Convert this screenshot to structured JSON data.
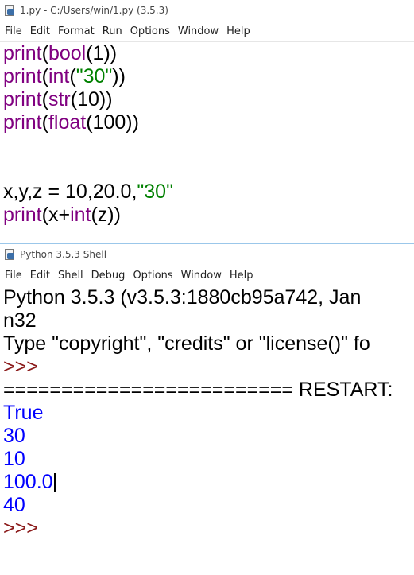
{
  "editor": {
    "title": "1.py - C:/Users/win/1.py (3.5.3)",
    "menu": [
      "File",
      "Edit",
      "Format",
      "Run",
      "Options",
      "Window",
      "Help"
    ],
    "lines": [
      [
        {
          "t": "print",
          "c": "kw"
        },
        {
          "t": "(",
          "c": ""
        },
        {
          "t": "bool",
          "c": "kw"
        },
        {
          "t": "(1))",
          "c": ""
        }
      ],
      [
        {
          "t": "print",
          "c": "kw"
        },
        {
          "t": "(",
          "c": ""
        },
        {
          "t": "int",
          "c": "kw"
        },
        {
          "t": "(",
          "c": ""
        },
        {
          "t": "\"30\"",
          "c": "str"
        },
        {
          "t": "))",
          "c": ""
        }
      ],
      [
        {
          "t": "print",
          "c": "kw"
        },
        {
          "t": "(",
          "c": ""
        },
        {
          "t": "str",
          "c": "kw"
        },
        {
          "t": "(10))",
          "c": ""
        }
      ],
      [
        {
          "t": "print",
          "c": "kw"
        },
        {
          "t": "(",
          "c": ""
        },
        {
          "t": "float",
          "c": "kw"
        },
        {
          "t": "(100))",
          "c": ""
        }
      ],
      [],
      [],
      [
        {
          "t": "x,y,z = 10,20.0,",
          "c": ""
        },
        {
          "t": "\"30\"",
          "c": "str"
        }
      ],
      [
        {
          "t": "print",
          "c": "kw"
        },
        {
          "t": "(x+",
          "c": ""
        },
        {
          "t": "int",
          "c": "kw"
        },
        {
          "t": "(z))",
          "c": ""
        }
      ]
    ]
  },
  "shell": {
    "title": "Python 3.5.3 Shell",
    "menu": [
      "File",
      "Edit",
      "Shell",
      "Debug",
      "Options",
      "Window",
      "Help"
    ],
    "lines": [
      [
        {
          "t": "Python 3.5.3 (v3.5.3:1880cb95a742, Jan",
          "c": ""
        }
      ],
      [
        {
          "t": "n32",
          "c": ""
        }
      ],
      [
        {
          "t": "Type \"copyright\", \"credits\" or \"license()\" fo",
          "c": ""
        }
      ],
      [
        {
          "t": ">>>",
          "c": "prompt"
        }
      ],
      [
        {
          "t": "========================= RESTART: ",
          "c": ""
        }
      ],
      [
        {
          "t": "True",
          "c": "out"
        }
      ],
      [
        {
          "t": "30",
          "c": "out"
        }
      ],
      [
        {
          "t": "10",
          "c": "out"
        }
      ],
      [
        {
          "t": "100.0",
          "c": "out"
        },
        {
          "t": "",
          "c": "cursor"
        }
      ],
      [
        {
          "t": "40",
          "c": "out"
        }
      ],
      [
        {
          "t": ">>>",
          "c": "prompt"
        }
      ]
    ]
  }
}
